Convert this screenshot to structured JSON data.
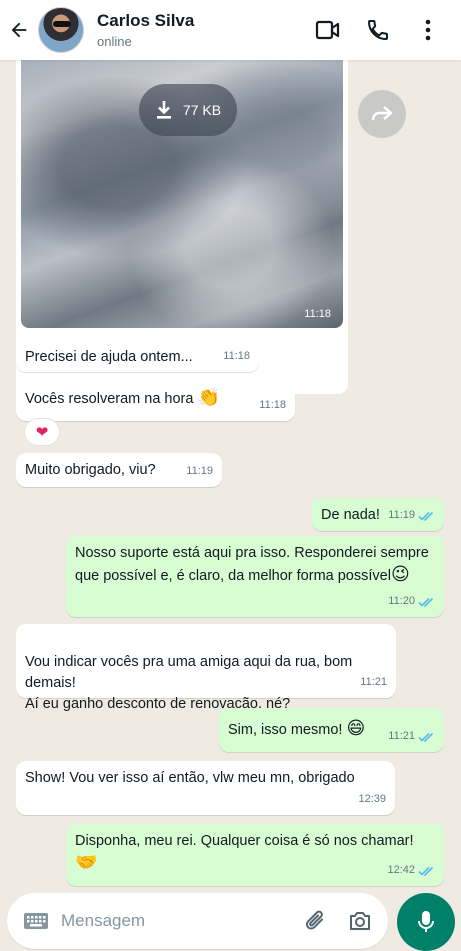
{
  "header": {
    "contact_name": "Carlos Silva",
    "status": "online",
    "icons": [
      "back-arrow-icon",
      "video-call-icon",
      "phone-icon",
      "more-vert-icon"
    ]
  },
  "media": {
    "size_label": "77 KB",
    "time": "11:18"
  },
  "messages": [
    {
      "direction": "in",
      "text": "Precisei de ajuda ontem...",
      "time": "11:18"
    },
    {
      "direction": "in",
      "text": "Vocês resolveram na hora",
      "emoji": "👏",
      "time": "11:18"
    },
    {
      "direction": "in",
      "text": "Muito obrigado, viu?",
      "time": "11:19"
    },
    {
      "direction": "out",
      "text": "De nada!",
      "time": "11:19"
    },
    {
      "direction": "out",
      "text": "Nosso suporte está aqui pra isso. Responderei sempre que possível e, é claro, da melhor forma possível",
      "emoji": "😉",
      "time": "11:20"
    },
    {
      "direction": "in",
      "text": "Vou indicar vocês pra uma amiga aqui da rua, bom demais!\nAí eu ganho desconto de renovação, né?",
      "time": "11:21"
    },
    {
      "direction": "out",
      "text": "Sim, isso mesmo!",
      "emoji": "😄",
      "time": "11:21"
    },
    {
      "direction": "in",
      "text": "Show! Vou ver isso aí então, vlw meu mn, obrigado",
      "time": "12:39"
    },
    {
      "direction": "out",
      "text": "Disponha, meu rei. Qualquer coisa é só nos chamar!",
      "emoji": "🤝",
      "time": "12:42"
    }
  ],
  "reaction": "❤",
  "input": {
    "placeholder": "Mensagem"
  },
  "colors": {
    "header_bg": "#ffffff",
    "chat_bg": "#efeae2",
    "incoming_bubble": "#ffffff",
    "outgoing_bubble": "#d9fdd3",
    "read_ticks": "#53bdeb",
    "mic_button": "#008069"
  }
}
